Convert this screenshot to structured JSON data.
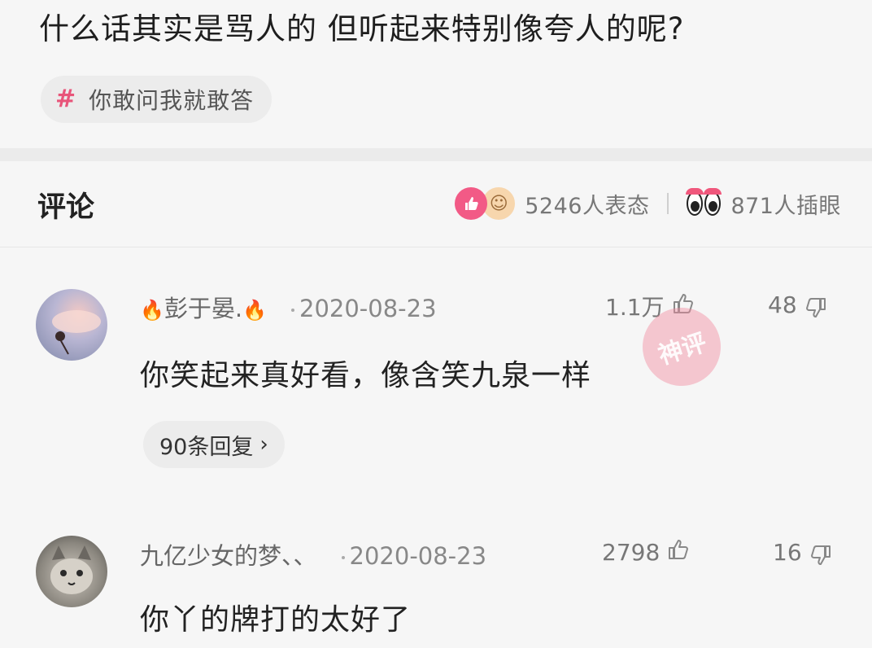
{
  "question": {
    "title": "什么话其实是骂人的  但听起来特别像夸人的呢?",
    "topic_hash": "#",
    "topic_label": "你敢问我就敢答"
  },
  "comments_header": {
    "title": "评论",
    "reactions_text": "5246人表态",
    "views_text": "871人插眼"
  },
  "comments": [
    {
      "username_prefix": "🔥",
      "username": "彭于晏.",
      "username_suffix": "🔥",
      "date": "2020-08-23",
      "likes": "1.1万",
      "dislikes": "48",
      "text": "你笑起来真好看，像含笑九泉一样",
      "replies": "90条回复",
      "stamp": "神评"
    },
    {
      "username": "九亿少女的梦、、",
      "date": "2020-08-23",
      "likes": "2798",
      "dislikes": "16",
      "text": "你丫的牌打的太好了"
    }
  ],
  "icons": {
    "thumb_up": "thumb-up-icon",
    "thumb_down": "thumb-down-icon",
    "chevron": "chevron-right-icon"
  },
  "colors": {
    "accent_pink": "#f25a86",
    "flame": "#ff6a13",
    "background": "#f6f6f6"
  }
}
